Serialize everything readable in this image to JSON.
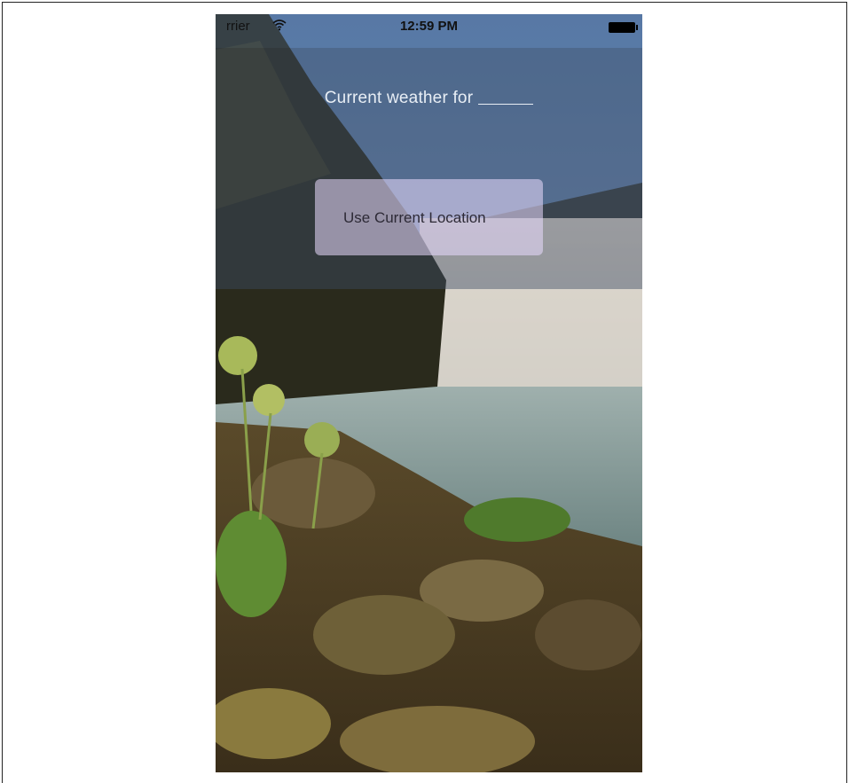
{
  "status_bar": {
    "carrier": "rrier",
    "time": "12:59 PM"
  },
  "main": {
    "headline": "Current weather for",
    "location_button_label": "Use Current Location"
  },
  "icons": {
    "wifi": "wifi-icon",
    "battery": "battery-icon"
  },
  "colors": {
    "overlay": "#3c4b64",
    "button_tint": "#ebdcff",
    "headline_text": "#e8eef5"
  }
}
